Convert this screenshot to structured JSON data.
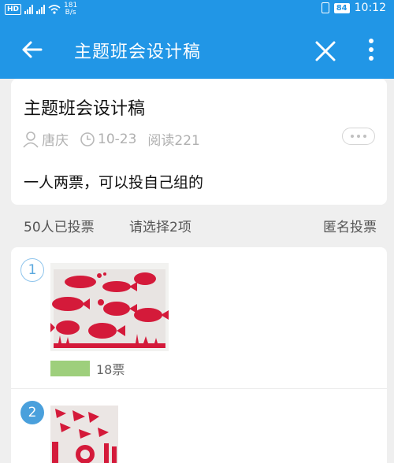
{
  "status_bar": {
    "hd_label": "HD",
    "network_speed_value": "181",
    "network_speed_unit": "B/s",
    "battery": "84",
    "time": "10:12"
  },
  "app_bar": {
    "title": "主题班会设计稿",
    "icons": [
      "back-arrow-icon",
      "close-icon",
      "more-vertical-icon"
    ]
  },
  "post": {
    "title": "主题班会设计稿",
    "author": "唐庆",
    "date": "10-23",
    "reads": "阅读221",
    "body": "一人两票，可以投自己组的"
  },
  "vote_info": {
    "voted_count": "50人已投票",
    "choose_hint": "请选择2项",
    "anonymous": "匿名投票"
  },
  "options": [
    {
      "number": "1",
      "votes_label": "18票",
      "vote_ratio": 0.36,
      "bar_color": "#9ecf7c",
      "selected": false
    },
    {
      "number": "2",
      "selected": true
    }
  ],
  "colors": {
    "accent": "#2196e6",
    "bar": "#9ecf7c"
  }
}
